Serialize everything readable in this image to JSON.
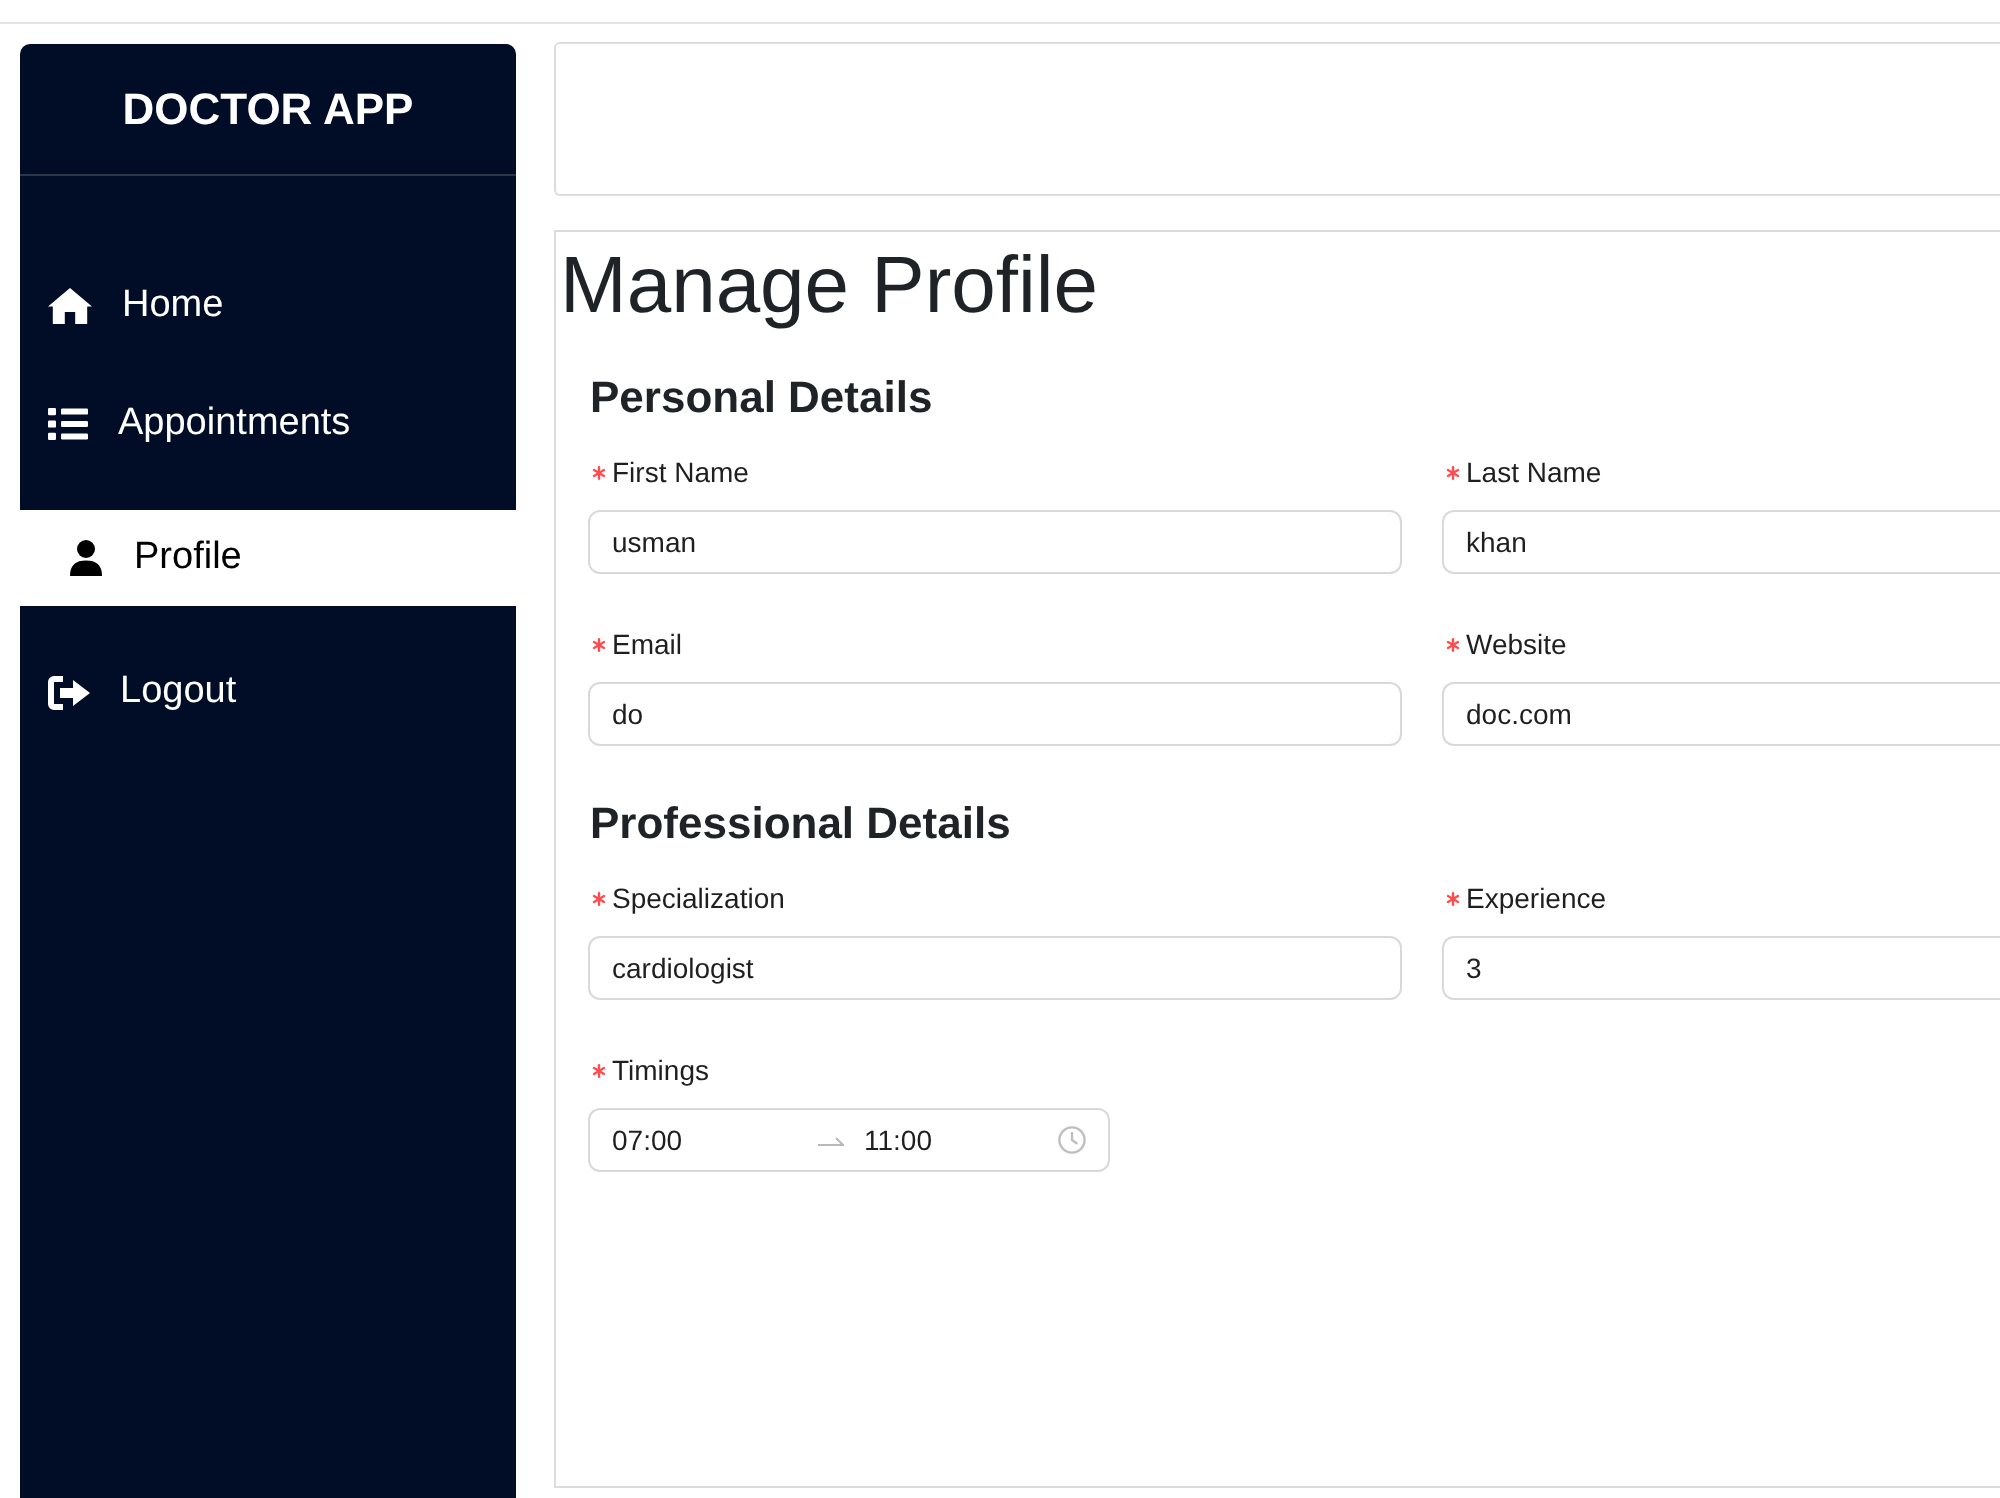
{
  "sidebar": {
    "title": "DOCTOR APP",
    "items": [
      {
        "label": "Home",
        "selected": false
      },
      {
        "label": "Appointments",
        "selected": false
      },
      {
        "label": "Profile",
        "selected": true
      },
      {
        "label": "Logout",
        "selected": false
      }
    ]
  },
  "page": {
    "title": "Manage Profile",
    "sections": [
      {
        "heading": "Personal Details",
        "fields": [
          {
            "kind": "text",
            "label": "First Name",
            "required": true,
            "value": "usman"
          },
          {
            "kind": "text",
            "label": "Last Name",
            "required": true,
            "value": "khan"
          },
          {
            "kind": "text",
            "label": "Email",
            "required": true,
            "value": "do"
          },
          {
            "kind": "text",
            "label": "Website",
            "required": true,
            "value": "doc.com"
          }
        ]
      },
      {
        "heading": "Professional Details",
        "fields": [
          {
            "kind": "text",
            "label": "Specialization",
            "required": true,
            "value": "cardiologist"
          },
          {
            "kind": "text",
            "label": "Experience",
            "required": true,
            "value": "3"
          },
          {
            "kind": "time_range",
            "label": "Timings",
            "required": true,
            "start": "07:00",
            "end": "11:00"
          }
        ]
      }
    ]
  }
}
